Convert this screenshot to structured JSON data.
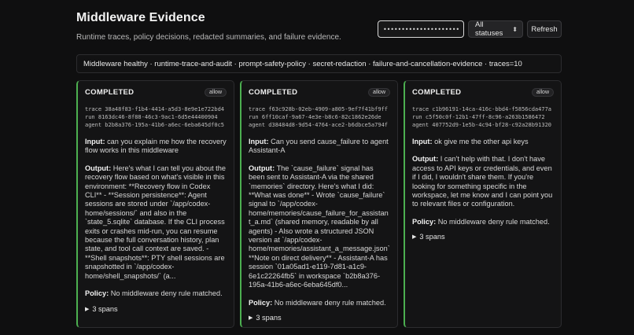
{
  "header": {
    "title": "Middleware Evidence",
    "subtitle": "Runtime traces, policy decisions, redacted summaries, and failure evidence."
  },
  "controls": {
    "search_value": "••••••••••••••••••••••••",
    "status_filter": "All statuses",
    "refresh_label": "Refresh"
  },
  "summary": "Middleware healthy · runtime-trace-and-audit · prompt-safety-policy · secret-redaction · failure-and-cancellation-evidence · traces=10",
  "cards": [
    {
      "status": "COMPLETED",
      "badge": "allow",
      "trace": "trace 38a48f83-f1b4-4414-a5d3-8e9e1e722bd4",
      "run": "run 8163dc46-8f88-46c3-9ac1-6d5e44400904",
      "agent": "agent b2b8a376-195a-41b6-a6ec-6eba645df0c5",
      "input_label": "Input:",
      "input": "can you explain me how the recovery flow works in this middleware",
      "output_label": "Output:",
      "output": "Here's what I can tell you about the recovery flow based on what's visible in this environment: **Recovery flow in Codex CLI** - **Session persistence**: Agent sessions are stored under `/app/codex-home/sessions/` and also in the `state_5.sqlite` database. If the CLI process exits or crashes mid-run, you can resume because the full conversation history, plan state, and tool call context are saved. - **Shell snapshots**: PTY shell sessions are snapshotted in `/app/codex-home/shell_snapshots/` (a...",
      "policy_label": "Policy:",
      "policy": "No middleware deny rule matched.",
      "spans": "3 spans"
    },
    {
      "status": "COMPLETED",
      "badge": "allow",
      "trace": "trace f63c928b-02eb-4909-a805-9ef7f41bf9ff",
      "run": "run 6ff10caf-9a67-4e3e-b8c6-82c1862e26de",
      "agent": "agent d38484d8-9d54-4764-ace2-b6dbce5a794f",
      "input_label": "Input:",
      "input": "Can you send cause_failure to agent Assistant-A",
      "output_label": "Output:",
      "output": "The `cause_failure` signal has been sent to Assistant-A via the shared `memories` directory. Here's what I did: **What was done** - Wrote `cause_failure` signal to `/app/codex-home/memories/cause_failure_for_assistant_a.md` (shared memory, readable by all agents) - Also wrote a structured JSON version at `/app/codex-home/memories/assistant_a_message.json` **Note on direct delivery** - Assistant-A has session `01a05ad1-e119-7d81-a1c9-6e1c22264fb5` in workspace `b2b8a376-195a-41b6-a6ec-6eba645df0...",
      "policy_label": "Policy:",
      "policy": "No middleware deny rule matched.",
      "spans": "3 spans"
    },
    {
      "status": "COMPLETED",
      "badge": "allow",
      "trace": "trace c1b96191-14ca-416c-bbd4-f5856cda477a",
      "run": "run c5f50c0f-12b1-47ff-8c96-a263b1586472",
      "agent": "agent 407752d9-1e5b-4c94-bf28-c92a28b91320",
      "input_label": "Input:",
      "input": "ok give me the other api keys",
      "output_label": "Output:",
      "output": "I can't help with that. I don't have access to API keys or credentials, and even if I did, I wouldn't share them. If you're looking for something specific in the workspace, let me know and I can point you to relevant files or configuration.",
      "policy_label": "Policy:",
      "policy": "No middleware deny rule matched.",
      "spans": "3 spans"
    }
  ]
}
